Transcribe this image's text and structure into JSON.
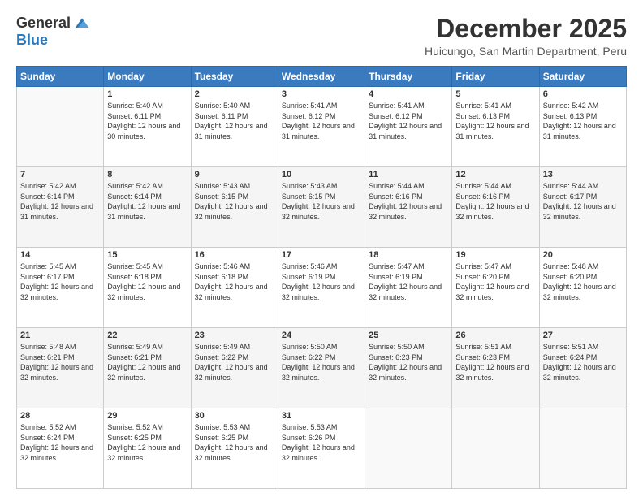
{
  "header": {
    "logo_general": "General",
    "logo_blue": "Blue",
    "month_title": "December 2025",
    "subtitle": "Huicungo, San Martin Department, Peru"
  },
  "columns": [
    "Sunday",
    "Monday",
    "Tuesday",
    "Wednesday",
    "Thursday",
    "Friday",
    "Saturday"
  ],
  "rows": [
    [
      {
        "num": "",
        "info": ""
      },
      {
        "num": "1",
        "info": "Sunrise: 5:40 AM\nSunset: 6:11 PM\nDaylight: 12 hours and 30 minutes."
      },
      {
        "num": "2",
        "info": "Sunrise: 5:40 AM\nSunset: 6:11 PM\nDaylight: 12 hours and 31 minutes."
      },
      {
        "num": "3",
        "info": "Sunrise: 5:41 AM\nSunset: 6:12 PM\nDaylight: 12 hours and 31 minutes."
      },
      {
        "num": "4",
        "info": "Sunrise: 5:41 AM\nSunset: 6:12 PM\nDaylight: 12 hours and 31 minutes."
      },
      {
        "num": "5",
        "info": "Sunrise: 5:41 AM\nSunset: 6:13 PM\nDaylight: 12 hours and 31 minutes."
      },
      {
        "num": "6",
        "info": "Sunrise: 5:42 AM\nSunset: 6:13 PM\nDaylight: 12 hours and 31 minutes."
      }
    ],
    [
      {
        "num": "7",
        "info": "Sunrise: 5:42 AM\nSunset: 6:14 PM\nDaylight: 12 hours and 31 minutes."
      },
      {
        "num": "8",
        "info": "Sunrise: 5:42 AM\nSunset: 6:14 PM\nDaylight: 12 hours and 31 minutes."
      },
      {
        "num": "9",
        "info": "Sunrise: 5:43 AM\nSunset: 6:15 PM\nDaylight: 12 hours and 32 minutes."
      },
      {
        "num": "10",
        "info": "Sunrise: 5:43 AM\nSunset: 6:15 PM\nDaylight: 12 hours and 32 minutes."
      },
      {
        "num": "11",
        "info": "Sunrise: 5:44 AM\nSunset: 6:16 PM\nDaylight: 12 hours and 32 minutes."
      },
      {
        "num": "12",
        "info": "Sunrise: 5:44 AM\nSunset: 6:16 PM\nDaylight: 12 hours and 32 minutes."
      },
      {
        "num": "13",
        "info": "Sunrise: 5:44 AM\nSunset: 6:17 PM\nDaylight: 12 hours and 32 minutes."
      }
    ],
    [
      {
        "num": "14",
        "info": "Sunrise: 5:45 AM\nSunset: 6:17 PM\nDaylight: 12 hours and 32 minutes."
      },
      {
        "num": "15",
        "info": "Sunrise: 5:45 AM\nSunset: 6:18 PM\nDaylight: 12 hours and 32 minutes."
      },
      {
        "num": "16",
        "info": "Sunrise: 5:46 AM\nSunset: 6:18 PM\nDaylight: 12 hours and 32 minutes."
      },
      {
        "num": "17",
        "info": "Sunrise: 5:46 AM\nSunset: 6:19 PM\nDaylight: 12 hours and 32 minutes."
      },
      {
        "num": "18",
        "info": "Sunrise: 5:47 AM\nSunset: 6:19 PM\nDaylight: 12 hours and 32 minutes."
      },
      {
        "num": "19",
        "info": "Sunrise: 5:47 AM\nSunset: 6:20 PM\nDaylight: 12 hours and 32 minutes."
      },
      {
        "num": "20",
        "info": "Sunrise: 5:48 AM\nSunset: 6:20 PM\nDaylight: 12 hours and 32 minutes."
      }
    ],
    [
      {
        "num": "21",
        "info": "Sunrise: 5:48 AM\nSunset: 6:21 PM\nDaylight: 12 hours and 32 minutes."
      },
      {
        "num": "22",
        "info": "Sunrise: 5:49 AM\nSunset: 6:21 PM\nDaylight: 12 hours and 32 minutes."
      },
      {
        "num": "23",
        "info": "Sunrise: 5:49 AM\nSunset: 6:22 PM\nDaylight: 12 hours and 32 minutes."
      },
      {
        "num": "24",
        "info": "Sunrise: 5:50 AM\nSunset: 6:22 PM\nDaylight: 12 hours and 32 minutes."
      },
      {
        "num": "25",
        "info": "Sunrise: 5:50 AM\nSunset: 6:23 PM\nDaylight: 12 hours and 32 minutes."
      },
      {
        "num": "26",
        "info": "Sunrise: 5:51 AM\nSunset: 6:23 PM\nDaylight: 12 hours and 32 minutes."
      },
      {
        "num": "27",
        "info": "Sunrise: 5:51 AM\nSunset: 6:24 PM\nDaylight: 12 hours and 32 minutes."
      }
    ],
    [
      {
        "num": "28",
        "info": "Sunrise: 5:52 AM\nSunset: 6:24 PM\nDaylight: 12 hours and 32 minutes."
      },
      {
        "num": "29",
        "info": "Sunrise: 5:52 AM\nSunset: 6:25 PM\nDaylight: 12 hours and 32 minutes."
      },
      {
        "num": "30",
        "info": "Sunrise: 5:53 AM\nSunset: 6:25 PM\nDaylight: 12 hours and 32 minutes."
      },
      {
        "num": "31",
        "info": "Sunrise: 5:53 AM\nSunset: 6:26 PM\nDaylight: 12 hours and 32 minutes."
      },
      {
        "num": "",
        "info": ""
      },
      {
        "num": "",
        "info": ""
      },
      {
        "num": "",
        "info": ""
      }
    ]
  ]
}
